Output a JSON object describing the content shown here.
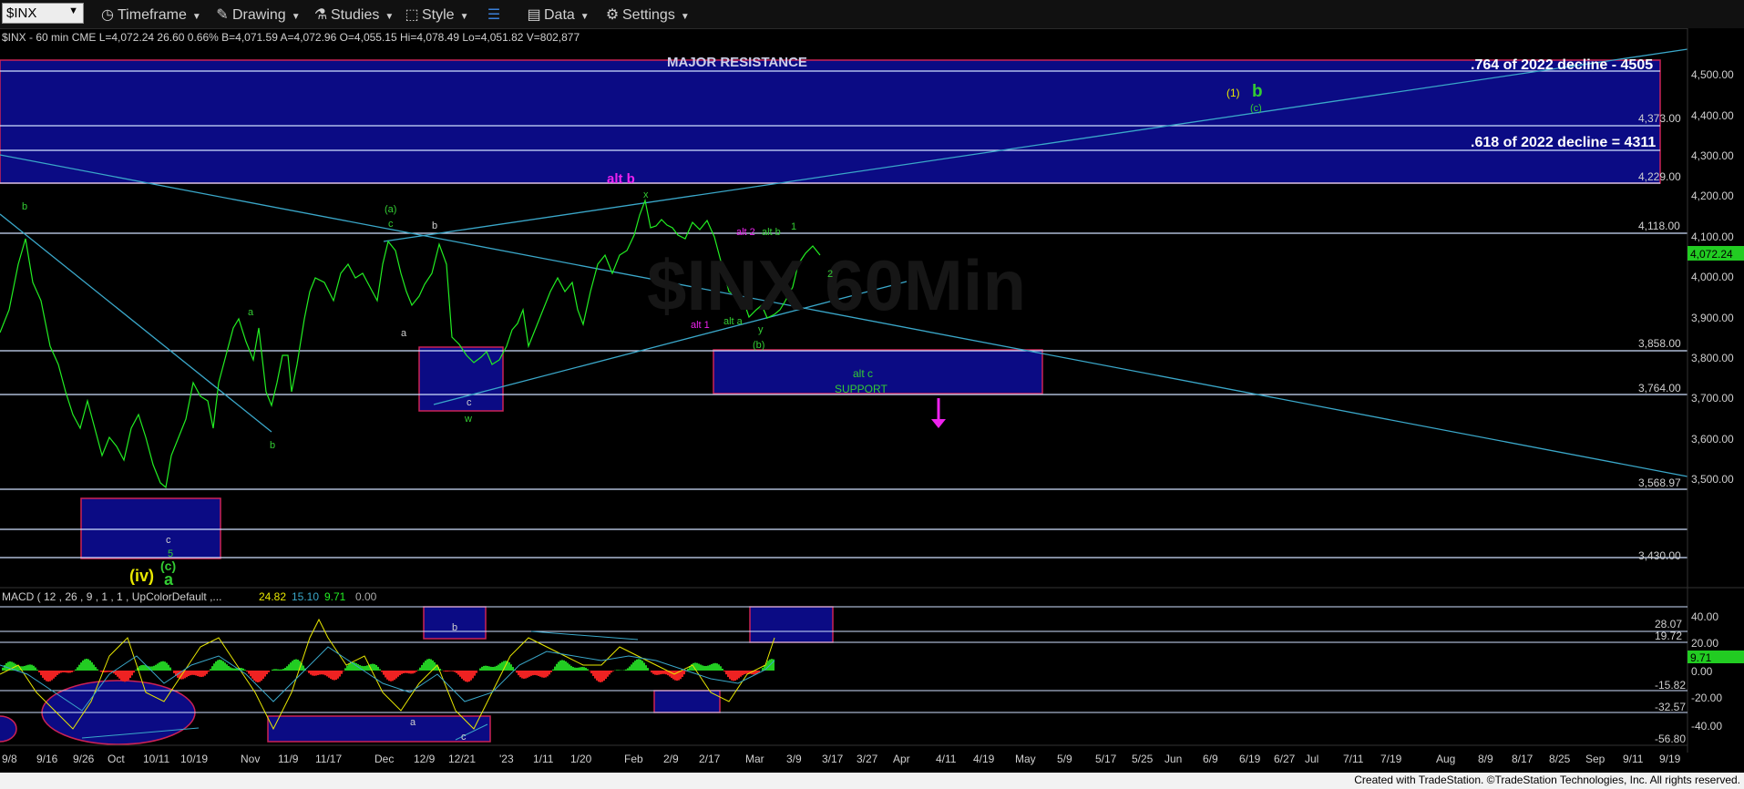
{
  "toolbar": {
    "symbol": "$INX",
    "timeframe": "Timeframe",
    "drawing": "Drawing",
    "studies": "Studies",
    "style": "Style",
    "data": "Data",
    "settings": "Settings"
  },
  "chart": {
    "header": "$INX - 60 min  CME  L=4,072.24  26.60  0.66%  B=4,071.59  A=4,072.96  O=4,055.15  Hi=4,078.49  Lo=4,051.82  V=802,877",
    "watermark": "$INX 60Min",
    "last_price": "4,072.24",
    "price_labels": [
      "4,500.00",
      "4,400.00",
      "4,300.00",
      "4,200.00",
      "4,100.00",
      "4,000.00",
      "3,900.00",
      "3,800.00",
      "3,700.00",
      "3,600.00",
      "3,500.00"
    ],
    "level_labels": [
      "4,373.00",
      "4,229.00",
      "4,118.00",
      "3,858.00",
      "3,764.00",
      "3,568.97",
      "3,430.00"
    ],
    "annotations": {
      "major_resistance": "MAJOR RESISTANCE",
      "fib_764": ".764 of 2022 decline - 4505",
      "fib_618": ".618 of 2022 decline = 4311",
      "support": "SUPPORT",
      "alt_c": "alt c",
      "alt_b": "alt b",
      "alt_2": "alt 2",
      "alt_b_small": "alt b",
      "alt_1": "alt 1",
      "alt_a": "alt a",
      "w1": "1",
      "w2": "2",
      "one_paren": "(1)",
      "b_big": "b",
      "c_paren_top": "(c)",
      "a_paren": "(a)",
      "c_small1": "c",
      "b_small1": "b",
      "x": "x",
      "y": "y",
      "b_paren": "(b)",
      "b_left": "b",
      "a_mid": "a",
      "b_mid": "b",
      "a_dec": "a",
      "c_dec": "c",
      "w": "w",
      "c_low": "c",
      "five": "5",
      "iv": "(iv)",
      "c_paren_low": "(c)",
      "a_big": "a"
    },
    "macd_header": "MACD ( 12 , 26 , 9 , 1 , 1 , UpColorDefault ,...",
    "macd_values": [
      "24.82",
      "15.10",
      "9.71",
      "0.00"
    ],
    "macd_last": "9.71",
    "macd_labels": [
      "40.00",
      "20.00",
      "0.00",
      "-20.00",
      "-40.00"
    ],
    "macd_levels": [
      "28.07",
      "19.72",
      "-15.82",
      "-32.57",
      "-56.80"
    ],
    "macd_annotations": {
      "b": "b",
      "a": "a",
      "c": "c"
    },
    "x_labels": [
      "9/8",
      "9/16",
      "9/26",
      "Oct",
      "10/11",
      "10/19",
      "Nov",
      "11/9",
      "11/17",
      "Dec",
      "12/9",
      "12/21",
      "'23",
      "1/11",
      "1/20",
      "Feb",
      "2/9",
      "2/17",
      "Mar",
      "3/9",
      "3/17",
      "3/27",
      "Apr",
      "4/11",
      "4/19",
      "May",
      "5/9",
      "5/17",
      "5/25",
      "Jun",
      "6/9",
      "6/19",
      "6/27",
      "Jul",
      "7/11",
      "7/19",
      "Aug",
      "8/9",
      "8/17",
      "8/25",
      "Sep",
      "9/11",
      "9/19"
    ]
  },
  "colors": {
    "resistance_fill": "#0b0b84",
    "price_line": "#22ee22",
    "trend_line": "#3aa7c9",
    "magenta": "#ee22ee",
    "green_label": "#33cc33",
    "yellow_label": "#e8e800"
  },
  "footer": "Created with TradeStation. ©TradeStation Technologies, Inc. All rights reserved."
}
